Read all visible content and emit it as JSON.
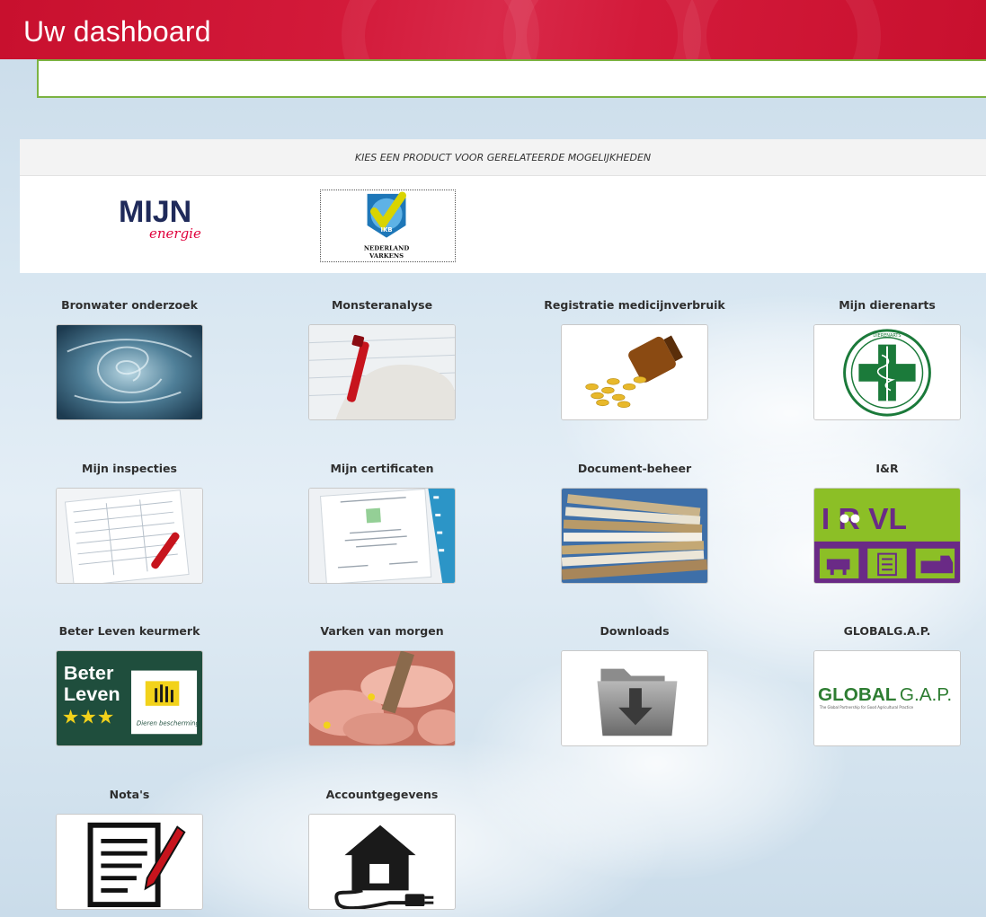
{
  "header": {
    "title": "Uw dashboard"
  },
  "products": {
    "caption": "KIES EEN PRODUCT VOOR GERELATEERDE MOGELIJKHEDEN",
    "mijn_logo": {
      "word": "MIJN",
      "sub": "energie"
    },
    "ikb_logo": {
      "badge": "IKB",
      "line1": "NEDERLAND",
      "line2": "VARKENS"
    }
  },
  "tiles": [
    {
      "label": "Bronwater onderzoek",
      "icon": "water-swirl-icon"
    },
    {
      "label": "Monsteranalyse",
      "icon": "blood-sample-icon"
    },
    {
      "label": "Registratie medicijnverbruik",
      "icon": "pills-bottle-icon"
    },
    {
      "label": "Mijn dierenarts",
      "icon": "veterinary-cross-icon"
    },
    {
      "label": "Mijn inspecties",
      "icon": "inspection-form-icon"
    },
    {
      "label": "Mijn certificaten",
      "icon": "certificate-icon"
    },
    {
      "label": "Document-beheer",
      "icon": "document-stack-icon"
    },
    {
      "label": "I&R",
      "icon": "ir-vl-icon"
    },
    {
      "label": "Beter Leven keurmerk",
      "icon": "beter-leven-icon"
    },
    {
      "label": "Varken van morgen",
      "icon": "pigs-icon"
    },
    {
      "label": "Downloads",
      "icon": "download-folder-icon"
    },
    {
      "label": "GLOBALG.A.P.",
      "icon": "globalgap-icon"
    },
    {
      "label": "Nota's",
      "icon": "invoice-note-icon"
    },
    {
      "label": "Accountgegevens",
      "icon": "house-plug-icon"
    }
  ],
  "thumb_text": {
    "ir_letters": "I  R VL",
    "beter": "Beter",
    "leven": "Leven",
    "stars": "★★★",
    "dierenbescherming": "Dieren bescherming",
    "globalgap_bold": "GLOBAL",
    "globalgap_light": "G.A.P.",
    "globalgap_tag": "The Global Partnership for Good Agricultural Practice",
    "vet_ring": "DIERENARTS"
  },
  "colors": {
    "brand_red": "#c8102e",
    "accent_green": "#7cb342",
    "ir_green": "#8cbf26",
    "ir_purple": "#6a2a86",
    "beter_leven_green": "#1f4e3d"
  }
}
